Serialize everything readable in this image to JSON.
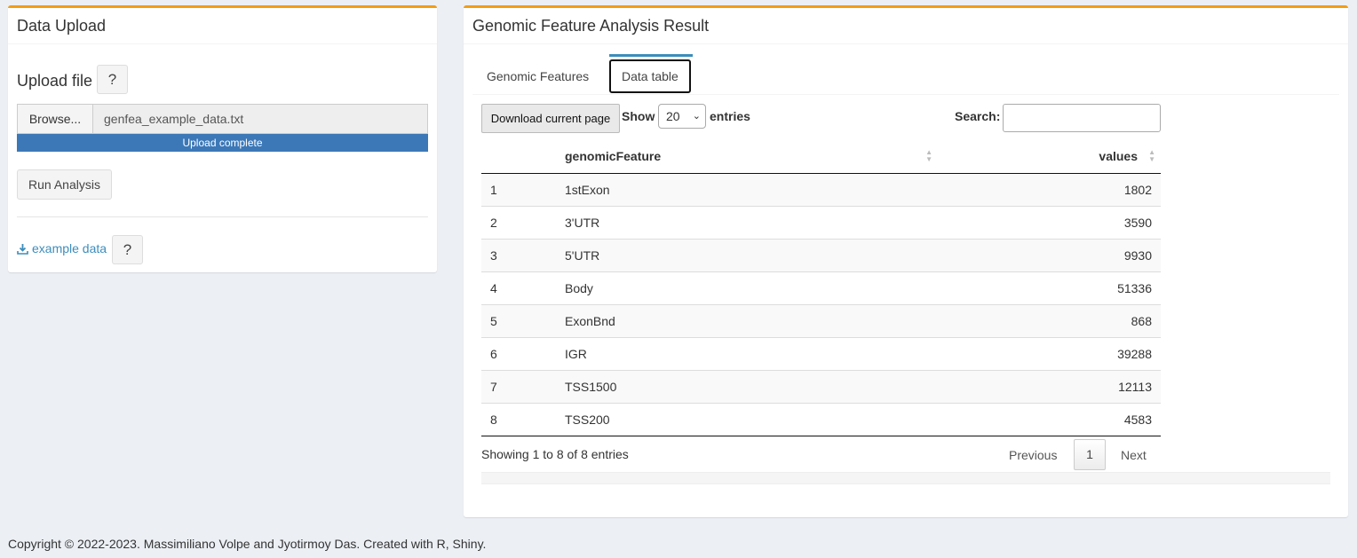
{
  "left_panel": {
    "title": "Data Upload",
    "upload_label": "Upload file",
    "help_text": "?",
    "browse_label": "Browse...",
    "file_name": "genfea_example_data.txt",
    "progress_text": "Upload complete",
    "progress_fraction": 1.0,
    "run_button": "Run Analysis",
    "example_link": "example data",
    "example_help": "?"
  },
  "right_panel": {
    "title": "Genomic Feature Analysis Result",
    "tabs": [
      {
        "label": "Genomic Features",
        "active": false
      },
      {
        "label": "Data table",
        "active": true
      }
    ],
    "download_button": "Download current page",
    "show_label": "Show",
    "entries_value": "20",
    "entries_label": "entries",
    "search_label": "Search:",
    "search_value": "",
    "table": {
      "columns": [
        "",
        "genomicFeature",
        "values"
      ],
      "rows": [
        {
          "index": "1",
          "feature": "1stExon",
          "value": "1802"
        },
        {
          "index": "2",
          "feature": "3'UTR",
          "value": "3590"
        },
        {
          "index": "3",
          "feature": "5'UTR",
          "value": "9930"
        },
        {
          "index": "4",
          "feature": "Body",
          "value": "51336"
        },
        {
          "index": "5",
          "feature": "ExonBnd",
          "value": "868"
        },
        {
          "index": "6",
          "feature": "IGR",
          "value": "39288"
        },
        {
          "index": "7",
          "feature": "TSS1500",
          "value": "12113"
        },
        {
          "index": "8",
          "feature": "TSS200",
          "value": "4583"
        }
      ]
    },
    "info_text": "Showing 1 to 8 of 8 entries",
    "pager": {
      "previous": "Previous",
      "current": "1",
      "next": "Next"
    }
  },
  "footer": "Copyright © 2022-2023. Massimiliano Volpe and Jyotirmoy Das. Created with R, Shiny.",
  "colors": {
    "accent_border": "#f39c12",
    "link": "#3c8dbc",
    "progress": "#3c78b8"
  }
}
